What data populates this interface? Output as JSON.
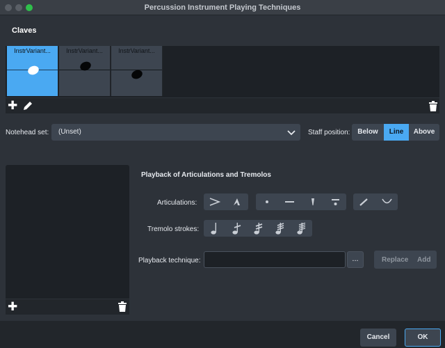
{
  "window": {
    "title": "Percussion Instrument Playing Techniques"
  },
  "instrument": {
    "name": "Claves"
  },
  "variants": [
    {
      "label": "InstrVariant..."
    },
    {
      "label": "InstrVariant..."
    },
    {
      "label": "InstrVariant..."
    }
  ],
  "notehead": {
    "label": "Notehead set:",
    "value": "(Unset)"
  },
  "staff_position": {
    "label": "Staff position:",
    "options": [
      "Below",
      "Line",
      "Above"
    ],
    "selected": "Line"
  },
  "playback": {
    "section_title": "Playback of Articulations and Tremolos",
    "articulations_label": "Articulations:",
    "tremolo_label": "Tremolo strokes:",
    "technique_label": "Playback technique:",
    "technique_value": "",
    "ellipsis_label": "...",
    "replace_label": "Replace",
    "add_label": "Add"
  },
  "footer": {
    "cancel_label": "Cancel",
    "ok_label": "OK"
  },
  "colors": {
    "accent": "#4aa9f2",
    "panel": "#2d3239",
    "dark": "#1d2126"
  }
}
